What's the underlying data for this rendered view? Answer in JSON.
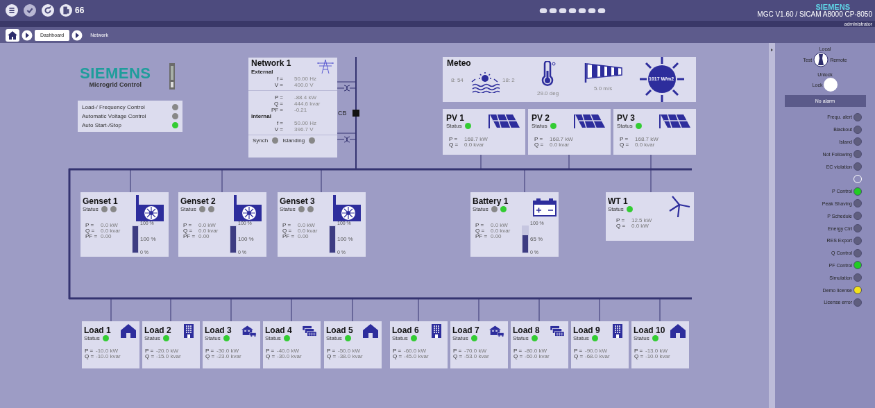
{
  "header": {
    "counter": "66",
    "brand": "SIEMENS",
    "version": "MGC V1.60 / SICAM A8000 CP-8050",
    "user": "administrator"
  },
  "breadcrumb": [
    {
      "label": "Dashboard",
      "selected": true
    },
    {
      "label": "Network",
      "selected": false
    }
  ],
  "logo": {
    "brand": "SIEMENS",
    "subtitle": "Microgrid Control"
  },
  "controls": [
    {
      "label": "Load-/ Frequency Control",
      "color": "#888888"
    },
    {
      "label": "Automatic Voltage Control",
      "color": "#888888"
    },
    {
      "label": "Auto Start-/Stop",
      "color": "#33cc33"
    }
  ],
  "network": {
    "title": "Network 1",
    "external": {
      "heading": "External",
      "rows": [
        {
          "label": "f =",
          "value": "50.00 Hz"
        },
        {
          "label": "V =",
          "value": "400.0 V"
        }
      ]
    },
    "power": [
      {
        "label": "P =",
        "value": "-88.4 kW"
      },
      {
        "label": "Q =",
        "value": "444.6 kvar"
      },
      {
        "label": "PF =",
        "value": "-0.21"
      }
    ],
    "internal": {
      "heading": "Internal",
      "rows": [
        {
          "label": "f =",
          "value": "50.00 Hz"
        },
        {
          "label": "V =",
          "value": "396.7 V"
        }
      ]
    },
    "breaker": "CB",
    "flags": [
      {
        "label": "Synch",
        "color": "#888888"
      },
      {
        "label": "Islanding",
        "color": "#888888"
      }
    ]
  },
  "meteo": {
    "title": "Meteo",
    "sunrise": "8: 54",
    "sunset": "18: 2",
    "temperature": "29.0 deg",
    "wind": "5.0 m/s",
    "irradiance": "1017 W/m2"
  },
  "pv": [
    {
      "title": "PV 1",
      "status_label": "Status",
      "status": [
        {
          "color": "#33cc33"
        }
      ],
      "rows": [
        {
          "label": "P =",
          "value": "168.7 kW"
        },
        {
          "label": "Q =",
          "value": "0.0 kvar"
        }
      ]
    },
    {
      "title": "PV 2",
      "status_label": "Status",
      "status": [
        {
          "color": "#33cc33"
        }
      ],
      "rows": [
        {
          "label": "P =",
          "value": "168.7 kW"
        },
        {
          "label": "Q =",
          "value": "0.0 kvar"
        }
      ]
    },
    {
      "title": "PV 3",
      "status_label": "Status",
      "status": [
        {
          "color": "#33cc33"
        }
      ],
      "rows": [
        {
          "label": "P =",
          "value": "168.7 kW"
        },
        {
          "label": "Q =",
          "value": "0.0 kvar"
        }
      ]
    }
  ],
  "sources": [
    {
      "kind": "genset",
      "title": "Genset 1",
      "status_label": "Status",
      "status": [
        {
          "color": "#888888"
        },
        {
          "color": "#888888"
        }
      ],
      "rows": [
        {
          "label": "P =",
          "value": "0.0 kW"
        },
        {
          "label": "Q =",
          "value": "0.0 kvar"
        },
        {
          "label": "PF =",
          "value": "0.00"
        }
      ],
      "gauge": {
        "level": 1,
        "reading": "100 %",
        "max": "100 %",
        "min": "0 %"
      }
    },
    {
      "kind": "genset",
      "title": "Genset 2",
      "status_label": "Status",
      "status": [
        {
          "color": "#888888"
        },
        {
          "color": "#888888"
        }
      ],
      "rows": [
        {
          "label": "P =",
          "value": "0.0 kW"
        },
        {
          "label": "Q =",
          "value": "0.0 kvar"
        },
        {
          "label": "PF =",
          "value": "0.00"
        }
      ],
      "gauge": {
        "level": 1,
        "reading": "100 %",
        "max": "100 %",
        "min": "0 %"
      }
    },
    {
      "kind": "genset",
      "title": "Genset 3",
      "status_label": "Status",
      "status": [
        {
          "color": "#888888"
        },
        {
          "color": "#888888"
        }
      ],
      "rows": [
        {
          "label": "P =",
          "value": "0.0 kW"
        },
        {
          "label": "Q =",
          "value": "0.0 kvar"
        },
        {
          "label": "PF =",
          "value": "0.00"
        }
      ],
      "gauge": {
        "level": 1,
        "reading": "100 %",
        "max": "100 %",
        "min": "0 %"
      }
    },
    {
      "kind": "battery",
      "title": "Battery 1",
      "status_label": "Status",
      "status": [
        {
          "color": "#888888"
        },
        {
          "color": "#33cc33"
        }
      ],
      "rows": [
        {
          "label": "P =",
          "value": "0.0 kW"
        },
        {
          "label": "Q =",
          "value": "0.0 kvar"
        },
        {
          "label": "PF =",
          "value": "0.00"
        }
      ],
      "gauge": {
        "level": 0.65,
        "reading": "65 %",
        "max": "100 %",
        "min": "0 %"
      }
    },
    {
      "kind": "wind",
      "title": "WT 1",
      "status_label": "Status",
      "status": [
        {
          "color": "#33cc33"
        }
      ],
      "rows": [
        {
          "label": "P =",
          "value": "12.5 kW"
        },
        {
          "label": "Q =",
          "value": "0.0 kW"
        }
      ]
    }
  ],
  "loads": [
    {
      "kind": "house",
      "title": "Load 1",
      "status_label": "Status",
      "color": "#33cc33",
      "rows": [
        {
          "label": "P =",
          "value": "-10.0 kW"
        },
        {
          "label": "Q =",
          "value": "-10.0 kvar"
        }
      ]
    },
    {
      "kind": "building",
      "title": "Load 2",
      "status_label": "Status",
      "color": "#33cc33",
      "rows": [
        {
          "label": "P =",
          "value": "-20.0 kW"
        },
        {
          "label": "Q =",
          "value": "-15.0 kvar"
        }
      ]
    },
    {
      "kind": "home-car",
      "title": "Load 3",
      "status_label": "Status",
      "color": "#33cc33",
      "rows": [
        {
          "label": "P =",
          "value": "-30.0 kW"
        },
        {
          "label": "Q =",
          "value": "-23.0 kvar"
        }
      ]
    },
    {
      "kind": "factory",
      "title": "Load 4",
      "status_label": "Status",
      "color": "#33cc33",
      "rows": [
        {
          "label": "P =",
          "value": "-40.0 kW"
        },
        {
          "label": "Q =",
          "value": "-30.0 kvar"
        }
      ]
    },
    {
      "kind": "house",
      "title": "Load 5",
      "status_label": "Status",
      "color": "#33cc33",
      "rows": [
        {
          "label": "P =",
          "value": "-50.0 kW"
        },
        {
          "label": "Q =",
          "value": "-38.0 kvar"
        }
      ]
    },
    {
      "kind": "building",
      "title": "Load 6",
      "status_label": "Status",
      "color": "#33cc33",
      "rows": [
        {
          "label": "P =",
          "value": "-60.0 kW"
        },
        {
          "label": "Q =",
          "value": "-45.0 kvar"
        }
      ]
    },
    {
      "kind": "home-car",
      "title": "Load 7",
      "status_label": "Status",
      "color": "#33cc33",
      "rows": [
        {
          "label": "P =",
          "value": "-70.0 kW"
        },
        {
          "label": "Q =",
          "value": "-53.0 kvar"
        }
      ]
    },
    {
      "kind": "factory",
      "title": "Load 8",
      "status_label": "Status",
      "color": "#33cc33",
      "rows": [
        {
          "label": "P =",
          "value": "-80.0 kW"
        },
        {
          "label": "Q =",
          "value": "-60.0 kvar"
        }
      ]
    },
    {
      "kind": "building",
      "title": "Load 9",
      "status_label": "Status",
      "color": "#33cc33",
      "rows": [
        {
          "label": "P =",
          "value": "-90.0 kW"
        },
        {
          "label": "Q =",
          "value": "-68.0 kvar"
        }
      ]
    },
    {
      "kind": "house",
      "title": "Load 10",
      "status_label": "Status",
      "color": "#33cc33",
      "rows": [
        {
          "label": "P =",
          "value": "-13.0 kW"
        },
        {
          "label": "Q =",
          "value": "-10.0 kvar"
        }
      ]
    }
  ],
  "side": {
    "mode_top": "Local",
    "mode_left": "Test",
    "mode_right": "Remote",
    "lock_top": "Unlock",
    "lock_left": "Lock",
    "alarm": "No alarm",
    "indicators": [
      {
        "kind": "lamp",
        "label": "Frequ. alert",
        "color": "#5f5e7e"
      },
      {
        "kind": "lamp",
        "label": "Blackout",
        "color": "#5f5e7e"
      },
      {
        "kind": "lamp",
        "label": "Island",
        "color": "#5f5e7e"
      },
      {
        "kind": "lamp",
        "label": "Not Following",
        "color": "#5f5e7e"
      },
      {
        "kind": "lamp",
        "label": "EC violation",
        "color": "#5f5e7e"
      },
      {
        "kind": "ring"
      },
      {
        "kind": "lamp",
        "label": "P Control",
        "color": "#22cc22"
      },
      {
        "kind": "lamp",
        "label": "Peak Shaving",
        "color": "#5f5e7e"
      },
      {
        "kind": "lamp",
        "label": "P Schedule",
        "color": "#5f5e7e"
      },
      {
        "kind": "lamp",
        "label": "Energy Ctrl",
        "color": "#5f5e7e"
      },
      {
        "kind": "lamp",
        "label": "RES Export",
        "color": "#5f5e7e"
      },
      {
        "kind": "lamp",
        "label": "Q Control",
        "color": "#5f5e7e"
      },
      {
        "kind": "lamp",
        "label": "PF Control",
        "color": "#22cc22"
      },
      {
        "kind": "lamp",
        "label": "Simulation",
        "color": "#5f5e7e"
      },
      {
        "kind": "lamp",
        "label": "Demo license",
        "color": "#f2e21a"
      },
      {
        "kind": "lamp",
        "label": "License error",
        "color": "#5f5e7e"
      }
    ]
  }
}
